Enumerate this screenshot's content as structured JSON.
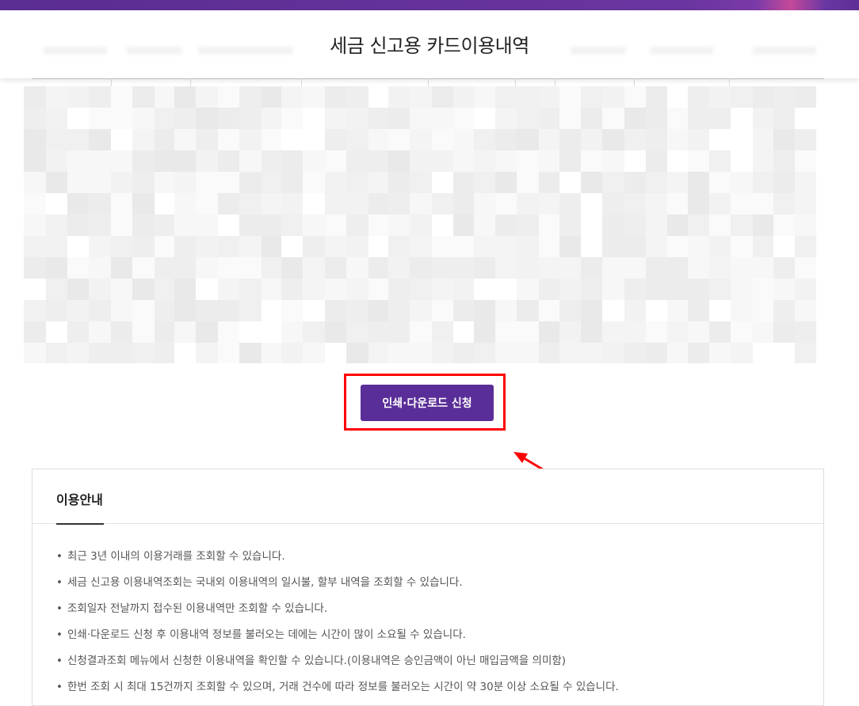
{
  "header": {
    "title": "세금 신고용 카드이용내역"
  },
  "actions": {
    "print_download_label": "인쇄·다운로드 신청"
  },
  "colors": {
    "brand_purple": "#5a2e98",
    "highlight_red": "#ff0000"
  },
  "usage_guide": {
    "title": "이용안내",
    "items": [
      "최근 3년 이내의 이용거래를 조회할 수 있습니다.",
      "세금 신고용 이용내역조회는 국내외 이용내역의 일시불, 할부 내역을 조회할 수 있습니다.",
      "조회일자 전날까지 접수된 이용내역만 조회할 수 있습니다.",
      "인쇄·다운로드 신청 후 이용내역 정보를 불러오는 데에는 시간이 많이 소요될 수 있습니다.",
      "신청결과조회 메뉴에서 신청한 이용내역을 확인할 수 있습니다.(이용내역은 승인금액이 아닌 매입금액을 의미함)",
      "한번 조회 시 최대 15건까지 조회할 수 있으며, 거래 건수에 따라 정보를 불러오는 시간이 약 30분 이상 소요될 수 있습니다."
    ],
    "bullet": "•"
  }
}
